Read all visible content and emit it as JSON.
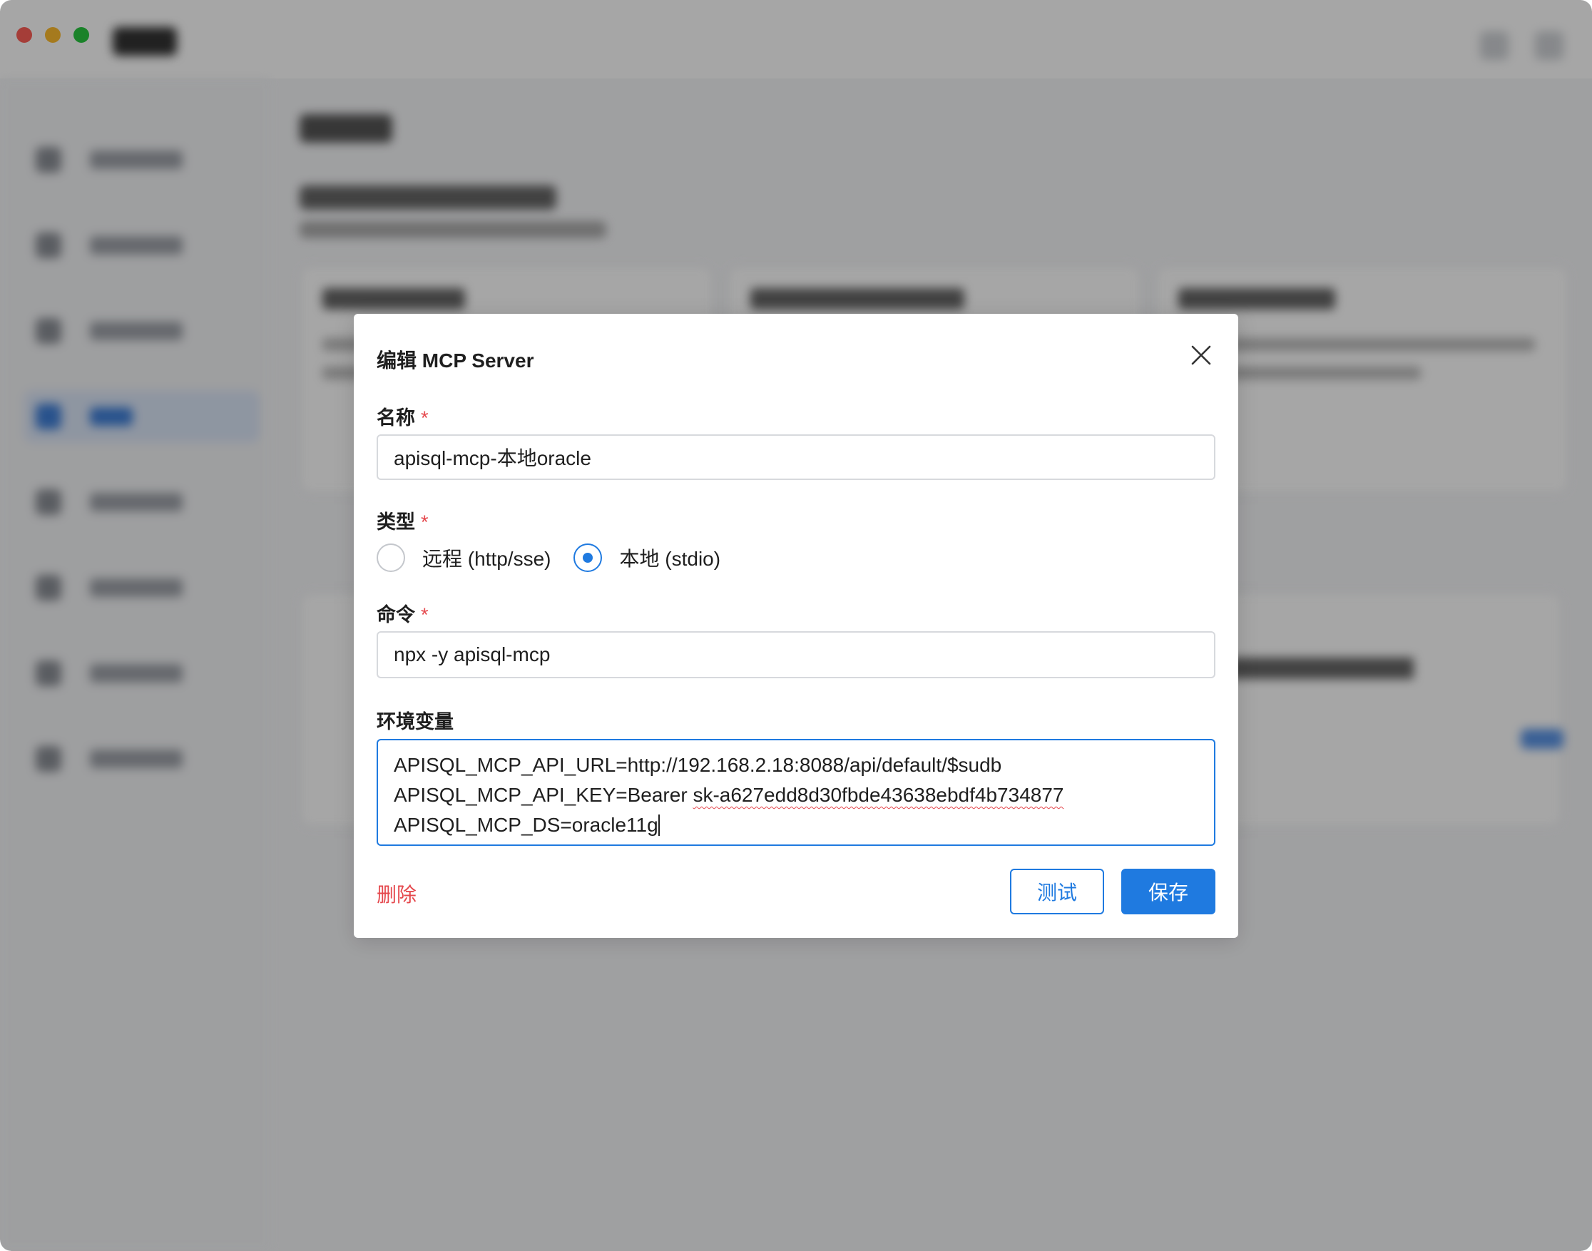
{
  "window": {
    "traffic_lights": [
      "close",
      "minimize",
      "zoom"
    ],
    "colors": {
      "red": "#fe5f57",
      "yellow": "#febc2e",
      "green": "#28c840"
    }
  },
  "modal": {
    "title": "编辑 MCP Server",
    "close_icon": "close-icon",
    "fields": {
      "name": {
        "label": "名称",
        "required_mark": "*",
        "value": "apisql-mcp-本地oracle"
      },
      "type": {
        "label": "类型",
        "required_mark": "*",
        "options": [
          {
            "label": "远程 (http/sse)",
            "checked": false
          },
          {
            "label": "本地 (stdio)",
            "checked": true
          }
        ]
      },
      "command": {
        "label": "命令",
        "required_mark": "*",
        "value": "npx -y apisql-mcp"
      },
      "env": {
        "label": "环境变量",
        "lines": [
          "APISQL_MCP_API_URL=http://192.168.2.18:8088/api/default/$sudb",
          "APISQL_MCP_API_KEY=Bearer ",
          "sk-a627edd8d30fbde43638ebdf4b734877",
          "APISQL_MCP_DS=oracle11g"
        ]
      }
    },
    "actions": {
      "delete": "删除",
      "test": "测试",
      "save": "保存"
    },
    "colors": {
      "accent": "#1f7ae0",
      "danger": "#e5484d"
    }
  }
}
